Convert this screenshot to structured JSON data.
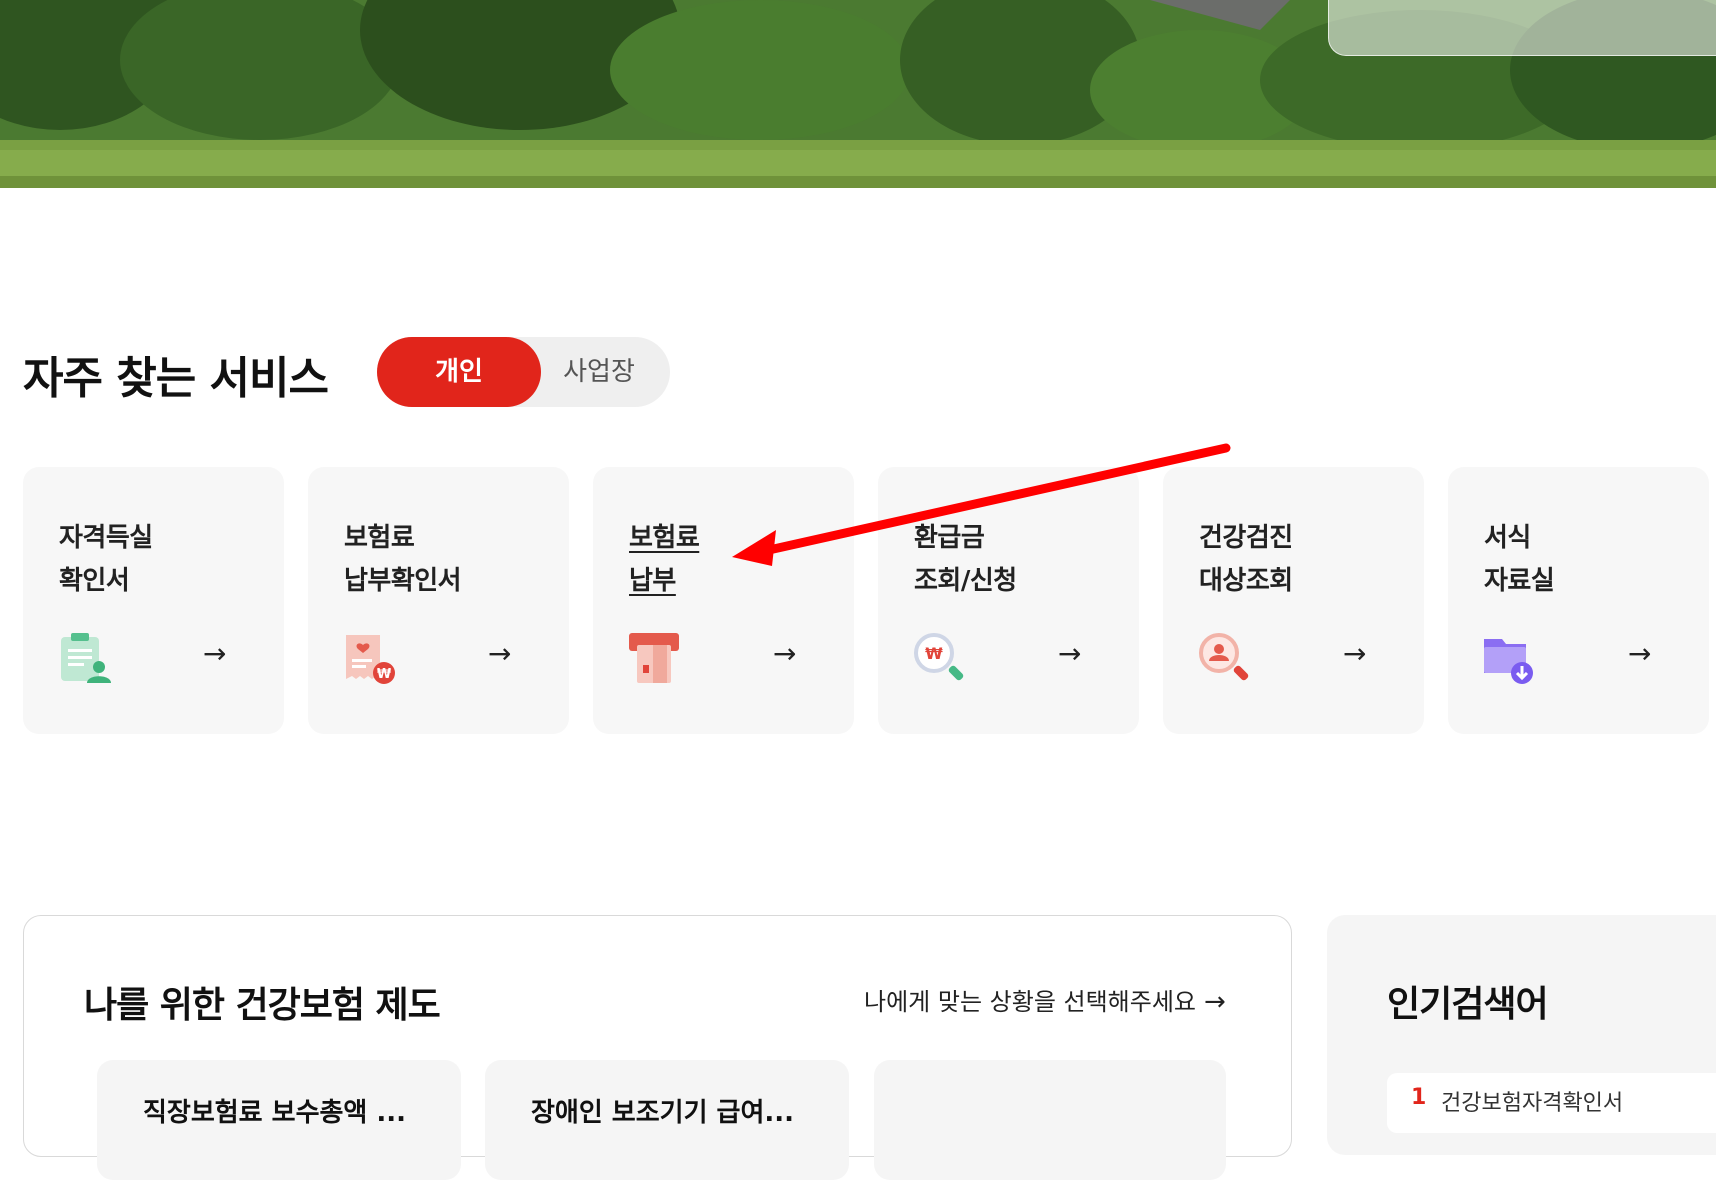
{
  "frequent_services": {
    "title": "자주 찾는 서비스",
    "tabs": {
      "active": "개인",
      "inactive": "사업장"
    },
    "cards": [
      {
        "line1": "자격득실",
        "line2": "확인서",
        "icon": "qualification-certificate-icon"
      },
      {
        "line1": "보험료",
        "line2": "납부확인서",
        "icon": "payment-receipt-icon"
      },
      {
        "line1": "보험료",
        "line2": "납부",
        "icon": "payment-card-icon"
      },
      {
        "line1": "환급금",
        "line2": "조회/신청",
        "icon": "refund-search-icon"
      },
      {
        "line1": "건강검진",
        "line2": "대상조회",
        "icon": "checkup-search-icon"
      },
      {
        "line1": "서식",
        "line2": "자료실",
        "icon": "forms-folder-icon"
      }
    ],
    "arrow_glyph": "→"
  },
  "health_system": {
    "title": "나를 위한 건강보험 제도",
    "link": "나에게 맞는 상황을 선택해주세요",
    "link_arrow": "→",
    "cards": [
      "직장보험료 보수총액 ...",
      "장애인 보조기기 급여...",
      ""
    ]
  },
  "popular_search": {
    "title": "인기검색어",
    "first_rank": "1",
    "first_item": "건강보험자격확인서"
  },
  "colors": {
    "accent": "#e1251b",
    "annotation_arrow": "#ff0000",
    "card_bg": "#f7f7f7",
    "toggle_bg": "#efefef"
  }
}
